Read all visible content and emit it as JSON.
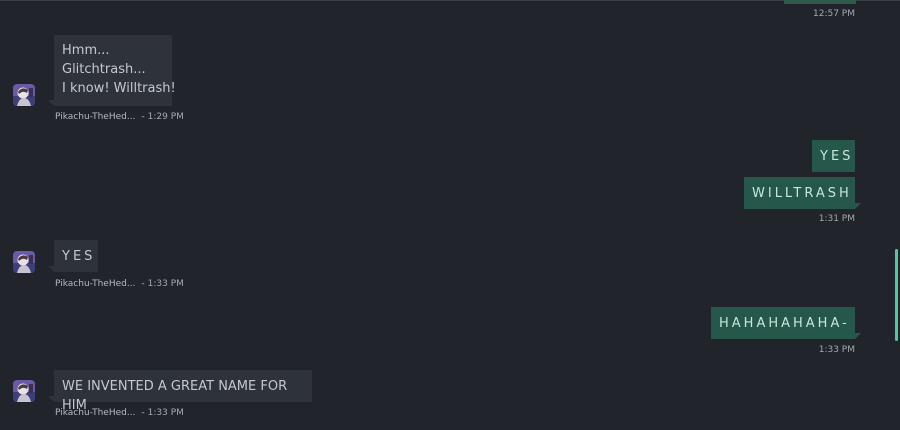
{
  "conversation": {
    "me": {
      "top_time": "12:57 PM",
      "messages": [
        {
          "text": "YES"
        },
        {
          "text": "WILLTRASH"
        }
      ],
      "group_time_1": "1:31 PM",
      "laugh_text": "HAHAHAHAHA-",
      "group_time_2": "1:33 PM"
    },
    "other": {
      "sender": "Pikachu-TheHed...",
      "separator": "-",
      "avatar_icon": "user-avatar-icon",
      "msg1": {
        "lines": [
          "Hmm...",
          "Glitchtrash...",
          "I know! Willtrash!"
        ],
        "time": "1:29 PM"
      },
      "msg2": {
        "text": "YES",
        "time": "1:33 PM"
      },
      "msg3": {
        "text": "WE INVENTED A GREAT NAME FOR HIM",
        "time": "1:33 PM"
      }
    }
  },
  "colors": {
    "background": "#21252b",
    "incoming_bubble": "#2e3239",
    "outgoing_bubble": "#25574a",
    "scroll_indicator": "#56c79a"
  }
}
